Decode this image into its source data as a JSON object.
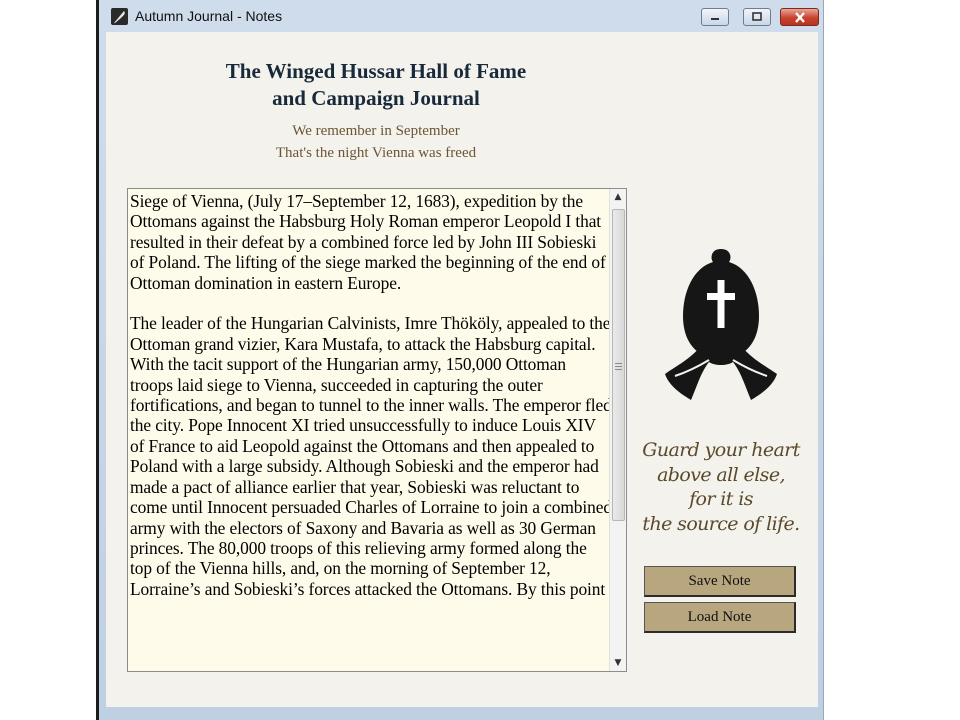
{
  "window": {
    "title": "Autumn Journal - Notes"
  },
  "header": {
    "title_line1": "The Winged Hussar Hall of Fame",
    "title_line2": "and Campaign Journal",
    "subtitle_line1": "We remember in September",
    "subtitle_line2": "That's the night Vienna was freed"
  },
  "notes": {
    "text": "Siege of Vienna, (July 17–September 12, 1683), expedition by the Ottomans against the Habsburg Holy Roman emperor Leopold I that resulted in their defeat by a combined force led by John III Sobieski of Poland. The lifting of the siege marked the beginning of the end of Ottoman domination in eastern Europe.\n\nThe leader of the Hungarian Calvinists, Imre Thököly, appealed to the Ottoman grand vizier, Kara Mustafa, to attack the Habsburg capital. With the tacit support of the Hungarian army, 150,000 Ottoman troops laid siege to Vienna, succeeded in capturing the outer fortifications, and began to tunnel to the inner walls. The emperor fled the city. Pope Innocent XI tried unsuccessfully to induce Louis XIV of France to aid Leopold against the Ottomans and then appealed to Poland with a large subsidy. Although Sobieski and the emperor had made a pact of alliance earlier that year, Sobieski was reluctant to come until Innocent persuaded Charles of Lorraine to join a combined army with the electors of Saxony and Bavaria as well as 30 German princes. The 80,000 troops of this relieving army formed along the top of the Vienna hills, and, on the morning of September 12, Lorraine’s and Sobieski’s forces attacked the Ottomans. By this point"
  },
  "quote": {
    "line1": "Guard your heart",
    "line2": "above all else,",
    "line3": "for it is",
    "line4": "the source of life."
  },
  "buttons": {
    "save_label": "Save Note",
    "load_label": "Load Note"
  },
  "icons": {
    "app": "quill-icon",
    "emblem": "hussar-cross-emblem-icon"
  },
  "colors": {
    "background": "#f4f2ec",
    "notes_background": "#fffbea",
    "button": "#b7a67e",
    "heading": "#17293a",
    "subtitle": "#6b5634"
  }
}
